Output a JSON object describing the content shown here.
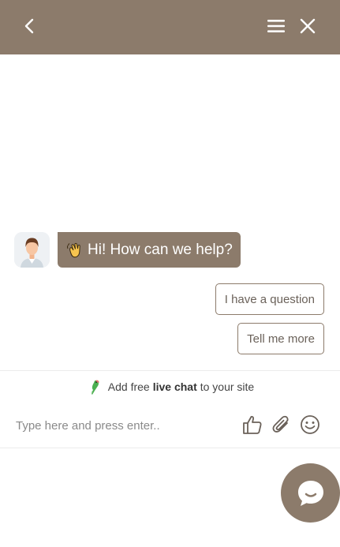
{
  "header": {
    "back_icon": "chevron-left-icon",
    "menu_icon": "hamburger-menu-icon",
    "close_icon": "close-icon",
    "background": "#8c7b6b"
  },
  "conversation": {
    "agent_avatar": "agent-avatar",
    "greeting_emoji": "waving-hand-icon",
    "greeting": "Hi! How can we help?",
    "quick_replies": [
      "I have a question",
      "Tell me more"
    ]
  },
  "promo": {
    "prefix": "Add free",
    "link": "live chat",
    "suffix": "to your site"
  },
  "composer": {
    "placeholder": "Type here and press enter..",
    "icons": [
      "thumbs-up-icon",
      "paperclip-icon",
      "smiley-icon"
    ]
  },
  "launcher": {
    "icon": "chat-bubble-icon"
  },
  "colors": {
    "accent": "#8c7b6b",
    "bubble_text": "#ffffff"
  }
}
